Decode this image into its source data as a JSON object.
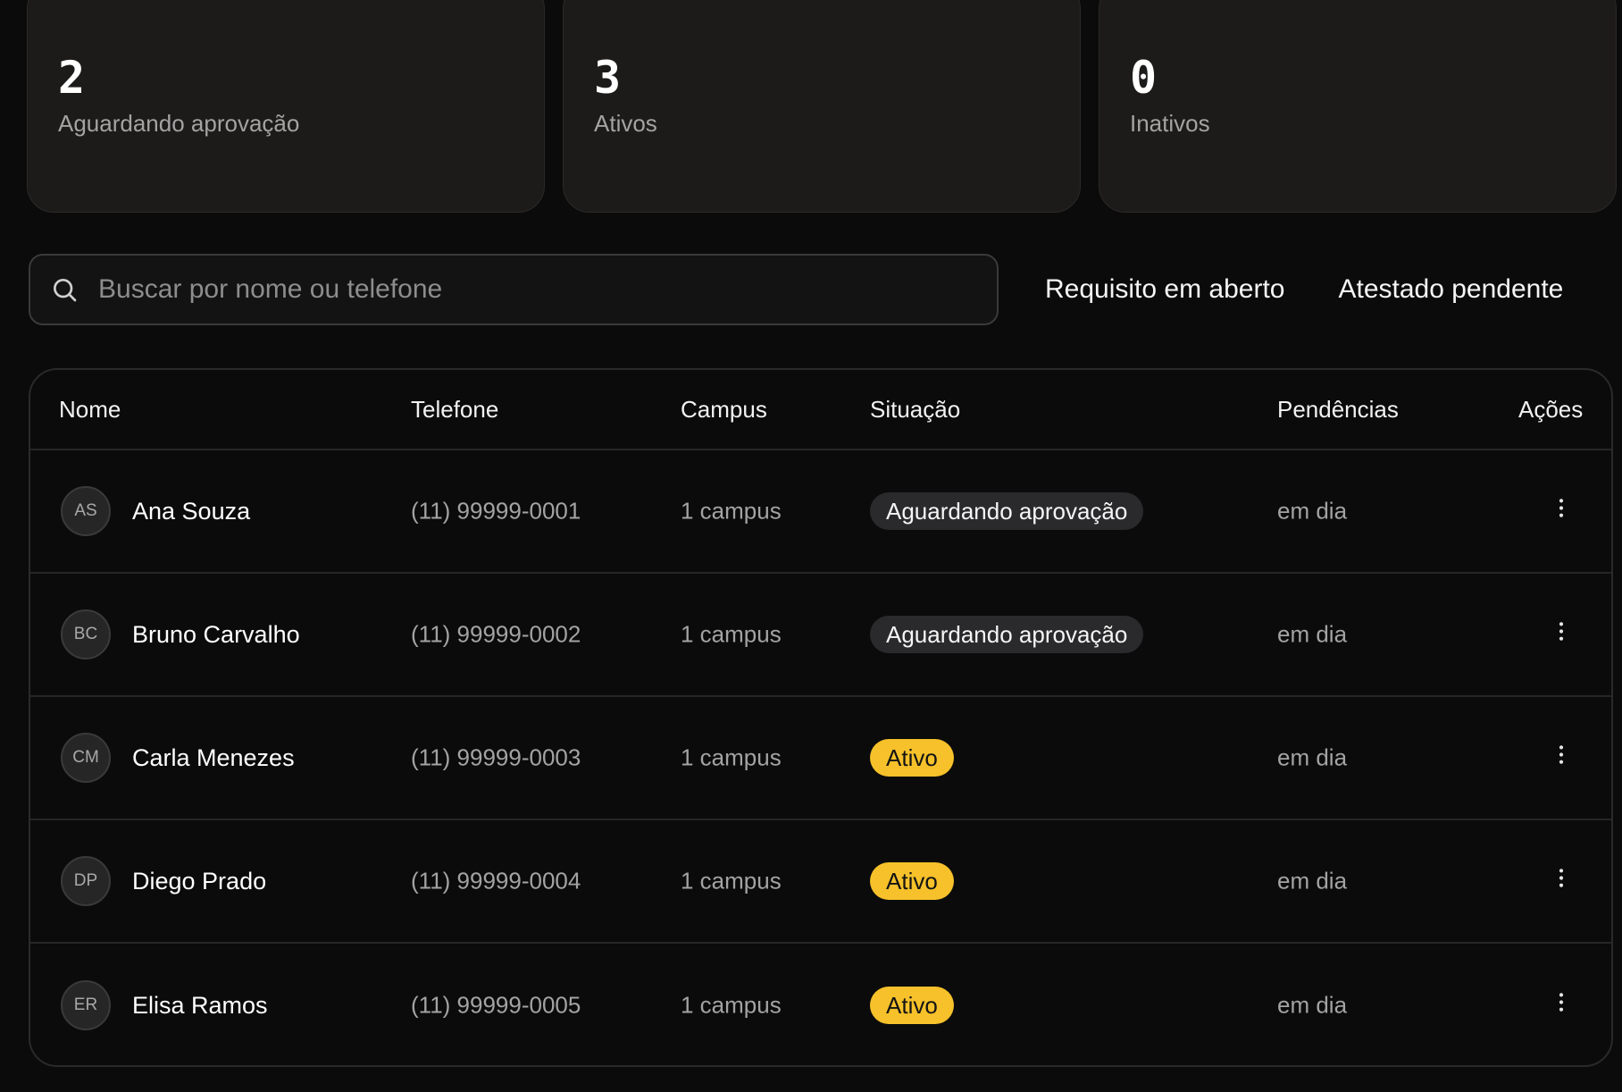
{
  "stats": [
    {
      "value": "2",
      "label": "Aguardando aprovação"
    },
    {
      "value": "3",
      "label": "Ativos"
    },
    {
      "value": "0",
      "label": "Inativos"
    }
  ],
  "search": {
    "placeholder": "Buscar por nome ou telefone",
    "value": ""
  },
  "filters": [
    "Requisito em aberto",
    "Atestado pendente"
  ],
  "table": {
    "columns": [
      "Nome",
      "Telefone",
      "Campus",
      "Situação",
      "Pendências",
      "Ações"
    ],
    "rows": [
      {
        "initials": "AS",
        "name": "Ana Souza",
        "phone": "(11) 99999-0001",
        "campus": "1 campus",
        "status": "Aguardando aprovação",
        "status_kind": "pending",
        "pendencias": "em dia"
      },
      {
        "initials": "BC",
        "name": "Bruno Carvalho",
        "phone": "(11) 99999-0002",
        "campus": "1 campus",
        "status": "Aguardando aprovação",
        "status_kind": "pending",
        "pendencias": "em dia"
      },
      {
        "initials": "CM",
        "name": "Carla Menezes",
        "phone": "(11) 99999-0003",
        "campus": "1 campus",
        "status": "Ativo",
        "status_kind": "active",
        "pendencias": "em dia"
      },
      {
        "initials": "DP",
        "name": "Diego Prado",
        "phone": "(11) 99999-0004",
        "campus": "1 campus",
        "status": "Ativo",
        "status_kind": "active",
        "pendencias": "em dia"
      },
      {
        "initials": "ER",
        "name": "Elisa Ramos",
        "phone": "(11) 99999-0005",
        "campus": "1 campus",
        "status": "Ativo",
        "status_kind": "active",
        "pendencias": "em dia"
      }
    ]
  },
  "icons": {
    "search": "search-icon",
    "row_actions": "more-vertical-icon"
  },
  "colors": {
    "background": "#0b0b0b",
    "card": "#1d1b1a",
    "accent": "#f6c12a",
    "pending_badge": "#2a2a2c"
  }
}
